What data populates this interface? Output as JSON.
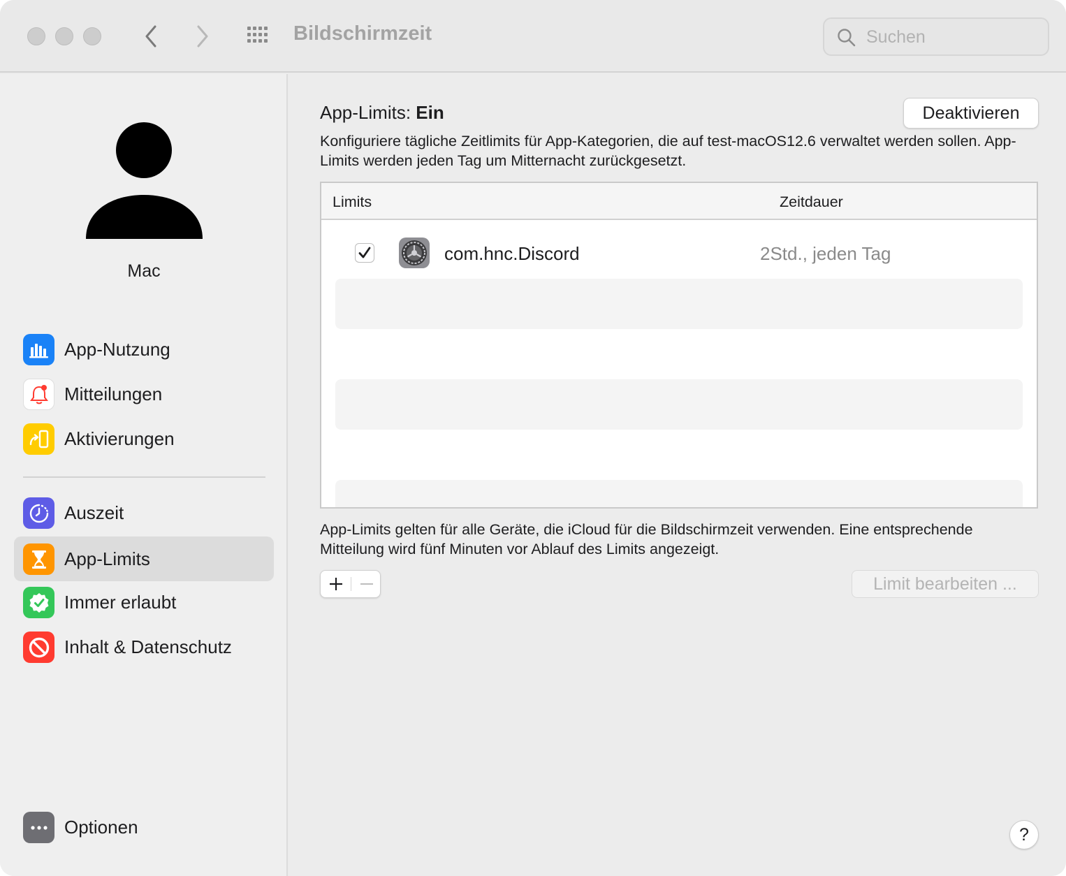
{
  "window": {
    "title": "Bildschirmzeit"
  },
  "search": {
    "placeholder": "Suchen"
  },
  "user": {
    "name": "Mac"
  },
  "sidebar": {
    "items": [
      {
        "label": "App-Nutzung",
        "icon": "bar-chart-icon",
        "color": "#1a82f7"
      },
      {
        "label": "Mitteilungen",
        "icon": "bell-icon",
        "color": "#ff3b30"
      },
      {
        "label": "Aktivierungen",
        "icon": "pickup-icon",
        "color": "#ffcc00"
      },
      {
        "label": "Auszeit",
        "icon": "downtime-icon",
        "color": "#5e5ce6"
      },
      {
        "label": "App-Limits",
        "icon": "hourglass-icon",
        "color": "#ff9500",
        "selected": true
      },
      {
        "label": "Immer erlaubt",
        "icon": "checkmark-seal-icon",
        "color": "#34c759"
      },
      {
        "label": "Inhalt & Datenschutz",
        "icon": "prohibited-icon",
        "color": "#ff3b30"
      }
    ],
    "options": {
      "label": "Optionen",
      "icon": "ellipsis-icon",
      "color": "#6e6e73"
    }
  },
  "main": {
    "status_prefix": "App-Limits:",
    "status_value": "Ein",
    "deactivate_label": "Deaktivieren",
    "description": "Konfiguriere tägliche Zeitlimits für App-Kategorien, die auf test-macOS12.6 verwaltet werden sollen. App-Limits werden jeden Tag um Mitternacht zurückgesetzt.",
    "table": {
      "columns": [
        "Limits",
        "Zeitdauer"
      ],
      "rows": [
        {
          "checked": true,
          "app": "com.hnc.Discord",
          "icon": "system-preferences-gear-icon",
          "duration": "2Std., jeden Tag"
        }
      ]
    },
    "info": "App-Limits gelten für alle Geräte, die iCloud für die Bildschirmzeit verwenden. Eine entsprechende Mitteilung wird fünf Minuten vor Ablauf des Limits angezeigt.",
    "add_label": "+",
    "remove_label": "−",
    "edit_label": "Limit bearbeiten ...",
    "help_label": "?"
  }
}
